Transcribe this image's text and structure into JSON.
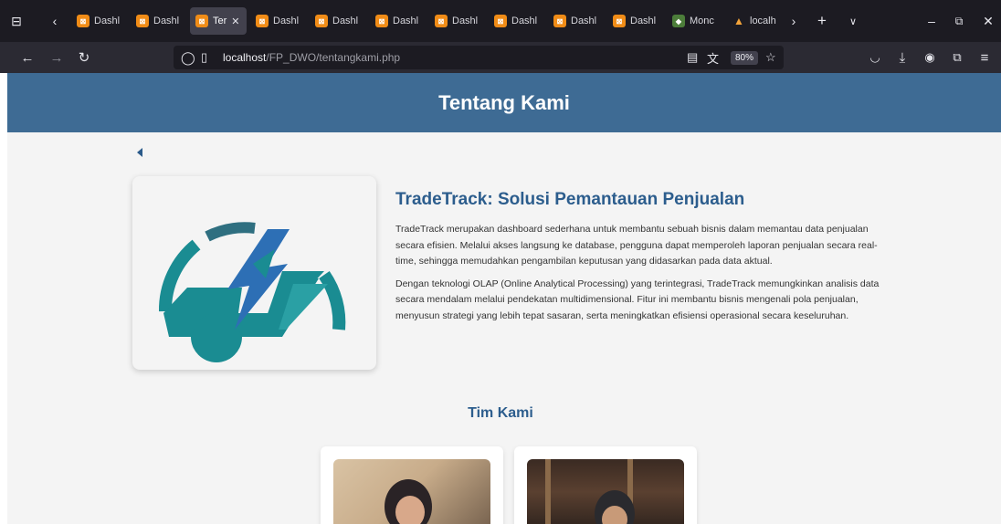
{
  "browser": {
    "tabs": [
      {
        "label": "Dashl",
        "favicon": "xampp-icon"
      },
      {
        "label": "Dashl",
        "favicon": "xampp-icon"
      },
      {
        "label": "Ter",
        "favicon": "xampp-icon",
        "active": true
      },
      {
        "label": "Dashl",
        "favicon": "xampp-icon"
      },
      {
        "label": "Dashl",
        "favicon": "xampp-icon"
      },
      {
        "label": "Dashl",
        "favicon": "xampp-icon"
      },
      {
        "label": "Dashl",
        "favicon": "xampp-icon"
      },
      {
        "label": "Dashl",
        "favicon": "xampp-icon"
      },
      {
        "label": "Dashl",
        "favicon": "xampp-icon"
      },
      {
        "label": "Dashl",
        "favicon": "xampp-icon"
      },
      {
        "label": "Monc",
        "favicon": "mongodb-icon"
      },
      {
        "label": "localh",
        "favicon": "phpmyadmin-icon"
      }
    ],
    "url_host": "localhost",
    "url_path": "/FP_DWO/tentangkami.php",
    "zoom": "80%"
  },
  "page": {
    "header_title": "Tentang Kami",
    "heading": "TradeTrack: Solusi Pemantauan Penjualan",
    "paragraph1": "TradeTrack merupakan dashboard sederhana untuk membantu sebuah bisnis dalam memantau data penjualan secara efisien. Melalui akses langsung ke database, pengguna dapat memperoleh laporan penjualan secara real-time, sehingga memudahkan pengambilan keputusan yang didasarkan pada data aktual.",
    "paragraph2": "Dengan teknologi OLAP (Online Analytical Processing) yang terintegrasi, TradeTrack memungkinkan analisis data secara mendalam melalui pendekatan multidimensional. Fitur ini membantu bisnis mengenali pola penjualan, menyusun strategi yang lebih tepat sasaran, serta meningkatkan efisiensi operasional secara keseluruhan.",
    "team_title": "Tim Kami"
  },
  "colors": {
    "header_bg": "#3e6b94",
    "accent": "#2c5d8d",
    "logo_teal": "#1a8c92",
    "logo_blue": "#2d6fb5"
  }
}
